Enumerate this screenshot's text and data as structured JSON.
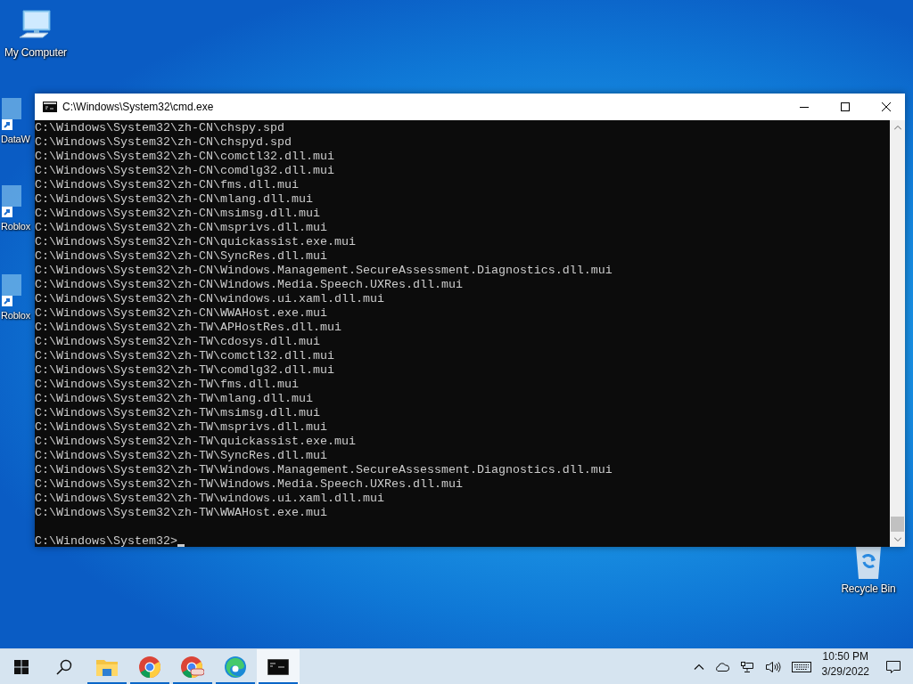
{
  "desktop_icons": [
    {
      "kind": "computer",
      "label": "My Computer"
    },
    {
      "kind": "shortcut",
      "label": "DataW"
    },
    {
      "kind": "shortcut",
      "label": "Roblox"
    },
    {
      "kind": "shortcut",
      "label": "Roblox"
    },
    {
      "kind": "recycle",
      "label": "Recycle Bin"
    }
  ],
  "window": {
    "title": "C:\\Windows\\System32\\cmd.exe",
    "lines": [
      "C:\\Windows\\System32\\zh-CN\\chspy.spd",
      "C:\\Windows\\System32\\zh-CN\\chspyd.spd",
      "C:\\Windows\\System32\\zh-CN\\comctl32.dll.mui",
      "C:\\Windows\\System32\\zh-CN\\comdlg32.dll.mui",
      "C:\\Windows\\System32\\zh-CN\\fms.dll.mui",
      "C:\\Windows\\System32\\zh-CN\\mlang.dll.mui",
      "C:\\Windows\\System32\\zh-CN\\msimsg.dll.mui",
      "C:\\Windows\\System32\\zh-CN\\msprivs.dll.mui",
      "C:\\Windows\\System32\\zh-CN\\quickassist.exe.mui",
      "C:\\Windows\\System32\\zh-CN\\SyncRes.dll.mui",
      "C:\\Windows\\System32\\zh-CN\\Windows.Management.SecureAssessment.Diagnostics.dll.mui",
      "C:\\Windows\\System32\\zh-CN\\Windows.Media.Speech.UXRes.dll.mui",
      "C:\\Windows\\System32\\zh-CN\\windows.ui.xaml.dll.mui",
      "C:\\Windows\\System32\\zh-CN\\WWAHost.exe.mui",
      "C:\\Windows\\System32\\zh-TW\\APHostRes.dll.mui",
      "C:\\Windows\\System32\\zh-TW\\cdosys.dll.mui",
      "C:\\Windows\\System32\\zh-TW\\comctl32.dll.mui",
      "C:\\Windows\\System32\\zh-TW\\comdlg32.dll.mui",
      "C:\\Windows\\System32\\zh-TW\\fms.dll.mui",
      "C:\\Windows\\System32\\zh-TW\\mlang.dll.mui",
      "C:\\Windows\\System32\\zh-TW\\msimsg.dll.mui",
      "C:\\Windows\\System32\\zh-TW\\msprivs.dll.mui",
      "C:\\Windows\\System32\\zh-TW\\quickassist.exe.mui",
      "C:\\Windows\\System32\\zh-TW\\SyncRes.dll.mui",
      "C:\\Windows\\System32\\zh-TW\\Windows.Management.SecureAssessment.Diagnostics.dll.mui",
      "C:\\Windows\\System32\\zh-TW\\Windows.Media.Speech.UXRes.dll.mui",
      "C:\\Windows\\System32\\zh-TW\\windows.ui.xaml.dll.mui",
      "C:\\Windows\\System32\\zh-TW\\WWAHost.exe.mui"
    ],
    "prompt": "C:\\Windows\\System32>"
  },
  "taskbar": {
    "items": [
      {
        "kind": "start",
        "running": false,
        "active": false
      },
      {
        "kind": "search",
        "running": false,
        "active": false
      },
      {
        "kind": "explorer",
        "running": true,
        "active": false
      },
      {
        "kind": "chrome",
        "running": true,
        "active": false
      },
      {
        "kind": "chrome-profile",
        "running": true,
        "active": false
      },
      {
        "kind": "edge",
        "running": true,
        "active": false
      },
      {
        "kind": "cmd",
        "running": true,
        "active": true
      }
    ],
    "clock": {
      "time": "10:50 PM",
      "date": "3/29/2022"
    }
  }
}
